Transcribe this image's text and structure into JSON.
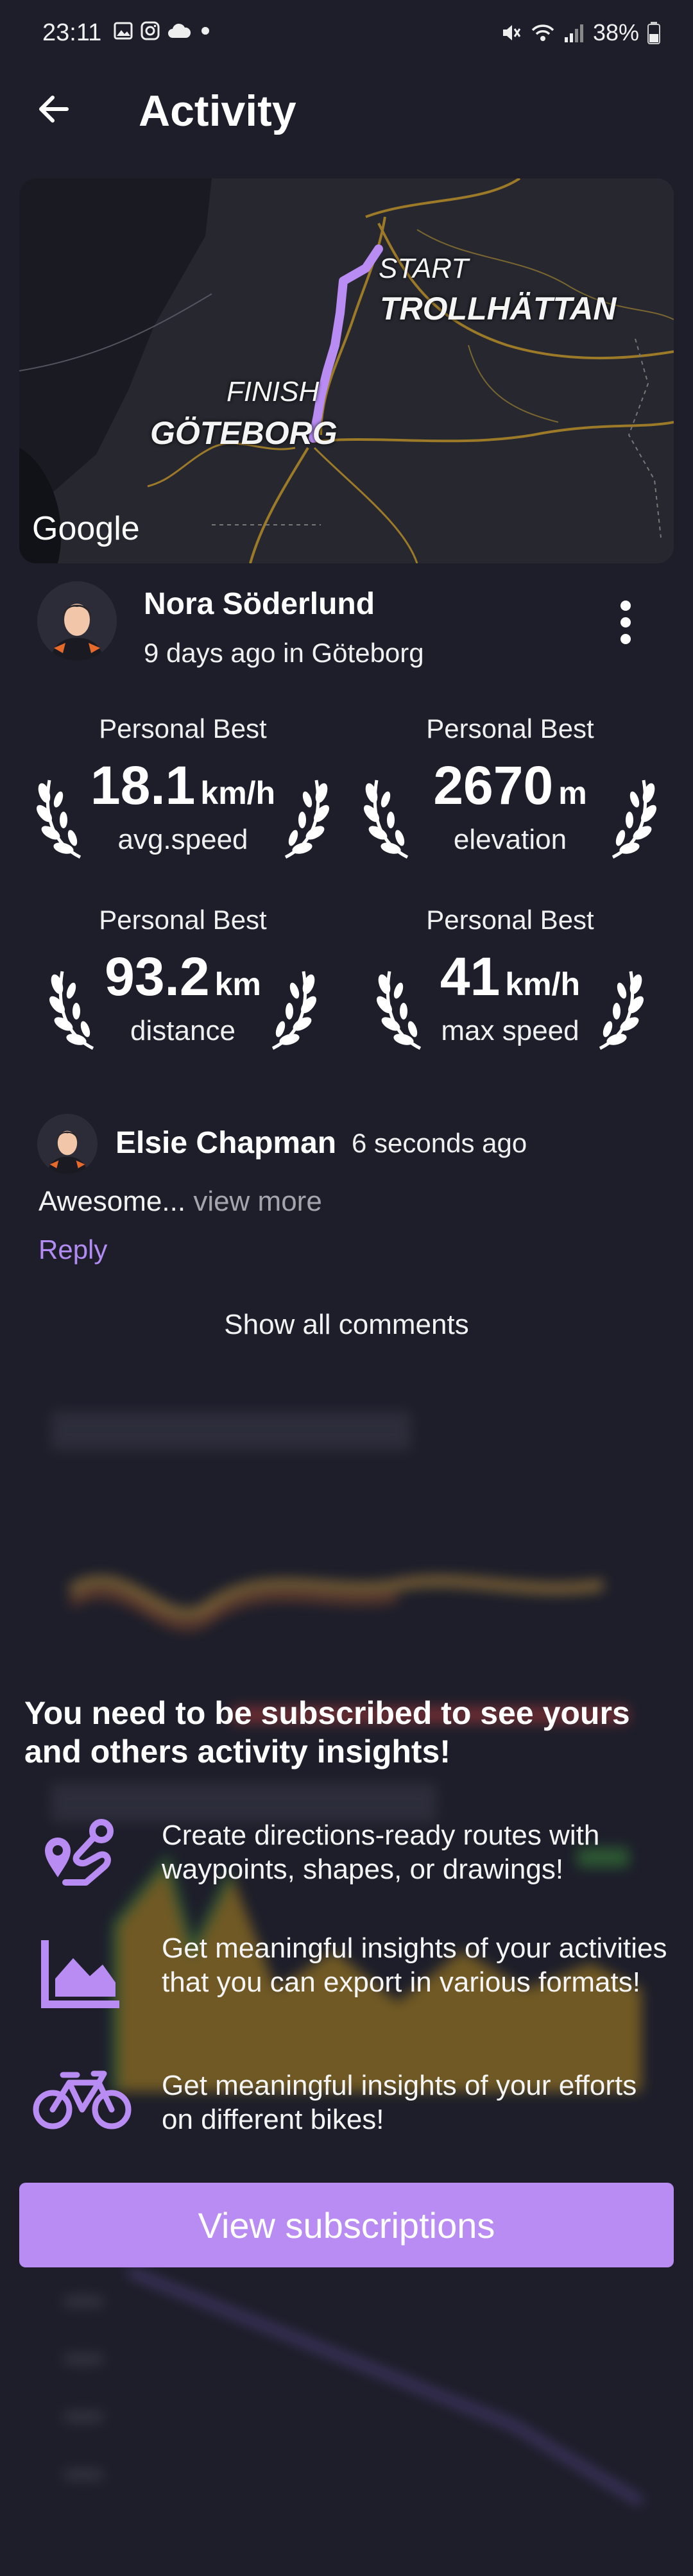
{
  "status_bar": {
    "time": "23:11",
    "battery": "38%",
    "icons_left": [
      "gallery-icon",
      "instagram-icon",
      "cloud-icon",
      "dot-icon"
    ],
    "icons_right": [
      "mute-icon",
      "wifi-icon",
      "signal-icon",
      "battery-icon"
    ]
  },
  "app_bar": {
    "title": "Activity"
  },
  "map": {
    "start_label": "START",
    "start_city": "TROLLHÄTTAN",
    "finish_label": "FINISH",
    "finish_city": "GÖTEBORG",
    "logo": "Google",
    "route_color": "#b98cf4"
  },
  "user": {
    "name": "Nora Söderlund",
    "subtitle": "9 days ago in Göteborg"
  },
  "badges": [
    {
      "title": "Personal Best",
      "value": "18.1",
      "unit": "km/h",
      "label": "avg.speed"
    },
    {
      "title": "Personal Best",
      "value": "2670",
      "unit": "m",
      "label": "elevation"
    },
    {
      "title": "Personal Best",
      "value": "93.2",
      "unit": "km",
      "label": "distance"
    },
    {
      "title": "Personal Best",
      "value": "41",
      "unit": "km/h",
      "label": "max speed"
    }
  ],
  "comment": {
    "author": "Elsie Chapman",
    "time": "6 seconds ago",
    "text": "Awesome...",
    "more": "view more",
    "reply": "Reply",
    "show_all": "Show all comments"
  },
  "subscription": {
    "heading": "You need to be subscribed to see yours and others activity insights!",
    "features": [
      {
        "icon": "route-icon",
        "text": "Create directions-ready routes with waypoints, shapes, or drawings!"
      },
      {
        "icon": "area-chart-icon",
        "text": "Get meaningful insights of your activities that you can export in various formats!"
      },
      {
        "icon": "bicycle-icon",
        "text": "Get meaningful insights of your efforts on different bikes!"
      }
    ],
    "button": "View subscriptions"
  },
  "colors": {
    "background": "#1d1e2a",
    "accent": "#b98cf4",
    "link": "#b28cf2"
  }
}
